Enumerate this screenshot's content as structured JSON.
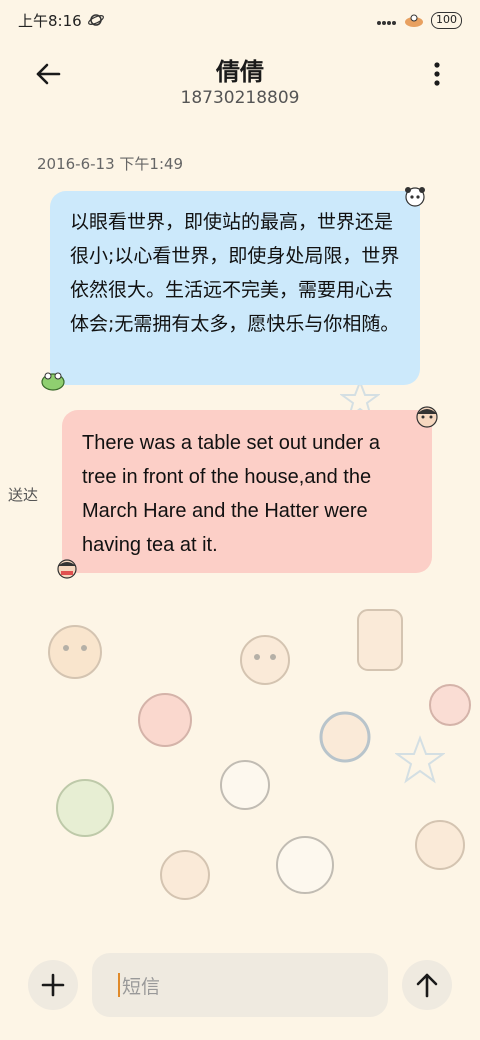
{
  "status_bar": {
    "time": "上午8:16",
    "battery": "100"
  },
  "header": {
    "contact_name": "倩倩",
    "contact_number": "18730218809",
    "back_icon": "arrow-left-icon",
    "more_icon": "more-vertical-icon"
  },
  "conversation": {
    "timestamp": "2016-6-13 下午1:49",
    "messages": [
      {
        "direction": "incoming",
        "text": "以眼看世界，即使站的最高，世界还是很小;以心看世界，即使身处局限，世界依然很大。生活远不完美，需要用心去体会;无需拥有太多，愿快乐与你相随。"
      },
      {
        "direction": "outgoing",
        "text": "There was a table set out under a tree in front of the house,and the March Hare and the Hatter were having tea at it.",
        "status": "送达"
      }
    ]
  },
  "composer": {
    "placeholder": "短信",
    "add_icon": "plus-icon",
    "send_icon": "arrow-up-icon"
  },
  "colors": {
    "background": "#fdf5e6",
    "incoming_bubble": "#cce9fb",
    "outgoing_bubble": "#fccfc7",
    "input_bg": "#efeae0",
    "caret": "#e08a2a"
  }
}
